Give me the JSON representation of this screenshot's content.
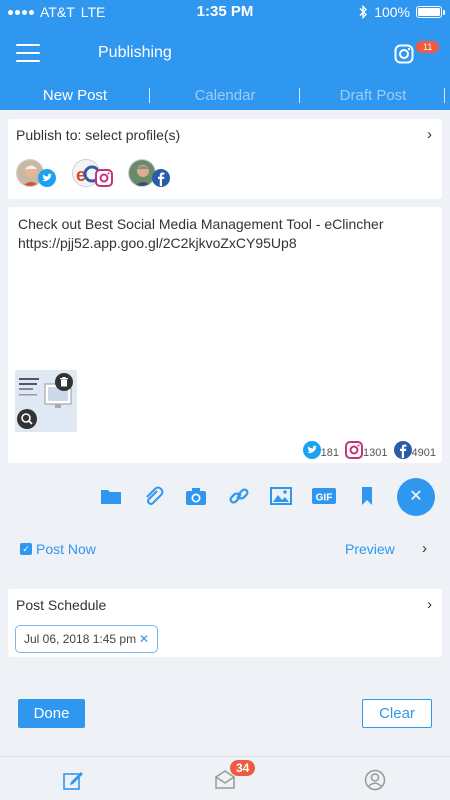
{
  "status_bar": {
    "carrier": "AT&T",
    "network": "LTE",
    "time": "1:35 PM",
    "battery": "100%"
  },
  "header": {
    "title": "Publishing",
    "notification_count": "11"
  },
  "tabs": [
    {
      "label": "New Post",
      "active": true
    },
    {
      "label": "Calendar",
      "active": false
    },
    {
      "label": "Draft Post",
      "active": false
    }
  ],
  "publish_to": {
    "label": "Publish to: select profile(s)"
  },
  "profiles": [
    {
      "network": "twitter"
    },
    {
      "network": "instagram"
    },
    {
      "network": "facebook"
    }
  ],
  "post": {
    "line1": "Check out Best Social Media Management Tool - eClincher",
    "line2": "https://pjj52.app.goo.gl/2C2kjkvoZxCY95Up8",
    "counts": {
      "twitter": "181",
      "instagram": "1301",
      "facebook": "4901"
    }
  },
  "toolbar": [
    "folder-icon",
    "attachment-icon",
    "camera-icon",
    "link-icon",
    "image-icon",
    "gif-icon",
    "bookmark-icon"
  ],
  "gif_label": "GIF",
  "post_now": {
    "label": "Post Now",
    "checked": true
  },
  "preview_label": "Preview",
  "schedule": {
    "label": "Post Schedule",
    "date": "Jul 06, 2018 1:45 pm"
  },
  "buttons": {
    "done": "Done",
    "clear": "Clear"
  },
  "bottom_nav": {
    "inbox_badge": "34"
  },
  "colors": {
    "primary": "#2f97f0",
    "badge": "#f05a3f",
    "twitter": "#1da1f2",
    "instagram": "#c1357a",
    "facebook": "#2a5da8"
  }
}
